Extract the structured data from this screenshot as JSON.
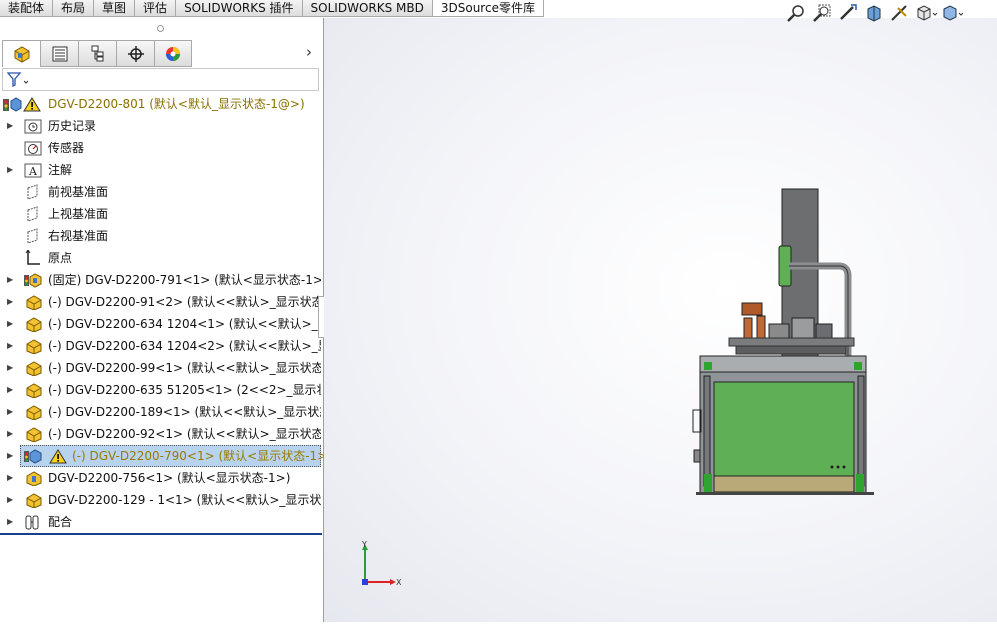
{
  "tabs": [
    "装配体",
    "布局",
    "草图",
    "评估",
    "SOLIDWORKS 插件",
    "SOLIDWORKS MBD",
    "3DSource零件库"
  ],
  "panel_tabs": [
    "feature-manager",
    "property-manager",
    "configuration-manager",
    "dimxpert-manager",
    "display-manager"
  ],
  "tree": {
    "root": "DGV-D2200-801  (默认<默认_显示状态-1@>)",
    "items": [
      {
        "label": "历史记录",
        "icon": "history-folder-icon",
        "arrow": true
      },
      {
        "label": "传感器",
        "icon": "sensor-icon",
        "arrow": false
      },
      {
        "label": "注解",
        "icon": "annotation-icon",
        "arrow": true
      },
      {
        "label": "前视基准面",
        "icon": "plane-icon",
        "arrow": false
      },
      {
        "label": "上视基准面",
        "icon": "plane-icon",
        "arrow": false
      },
      {
        "label": "右视基准面",
        "icon": "plane-icon",
        "arrow": false
      },
      {
        "label": "原点",
        "icon": "origin-icon",
        "arrow": false
      },
      {
        "label": "(固定) DGV-D2200-791<1> (默认<显示状态-1>)",
        "icon": "subassembly-icon",
        "arrow": true
      },
      {
        "label": "(-) DGV-D2200-91<2> (默认<<默认>_显示状态 1",
        "icon": "part-icon",
        "arrow": true
      },
      {
        "label": "(-) DGV-D2200-634 1204<1> (默认<<默认>_显示",
        "icon": "part-icon",
        "arrow": true
      },
      {
        "label": "(-) DGV-D2200-634 1204<2> (默认<<默认>_显示",
        "icon": "part-icon",
        "arrow": true
      },
      {
        "label": "(-) DGV-D2200-99<1> (默认<<默认>_显示状态 1",
        "icon": "part-icon",
        "arrow": true
      },
      {
        "label": "(-) DGV-D2200-635 51205<1> (2<<2>_显示状态",
        "icon": "part-icon",
        "arrow": true
      },
      {
        "label": "(-) DGV-D2200-189<1> (默认<<默认>_显示状态",
        "icon": "part-icon",
        "arrow": true
      },
      {
        "label": "(-) DGV-D2200-92<1> (默认<<默认>_显示状态 1",
        "icon": "part-icon",
        "arrow": true
      },
      {
        "label": "(-) DGV-D2200-790<1> (默认<显示状态-1>)",
        "icon": "subassembly-warning-icon",
        "arrow": true,
        "selected": true
      },
      {
        "label": "DGV-D2200-756<1> (默认<显示状态-1>)",
        "icon": "subassembly-icon",
        "arrow": true
      },
      {
        "label": "DGV-D2200-129 - 1<1> (默认<<默认>_显示状态",
        "icon": "part-icon",
        "arrow": true
      },
      {
        "label": "配合",
        "icon": "mates-icon",
        "arrow": true
      }
    ]
  },
  "triad": {
    "y": "Y",
    "x": "X"
  },
  "colors": {
    "machine_green": "#5fb055",
    "frame_gray": "#8f9498",
    "column_gray": "#6c6e70",
    "selection": "#b7d3ee",
    "accent_blue": "#1a3d8f"
  },
  "headsup_icons": [
    "zoom-to-fit-icon",
    "zoom-to-area-icon",
    "previous-view-icon",
    "section-view-icon",
    "dynamic-annotation-icon",
    "view-orientation-icon",
    "display-style-icon"
  ]
}
